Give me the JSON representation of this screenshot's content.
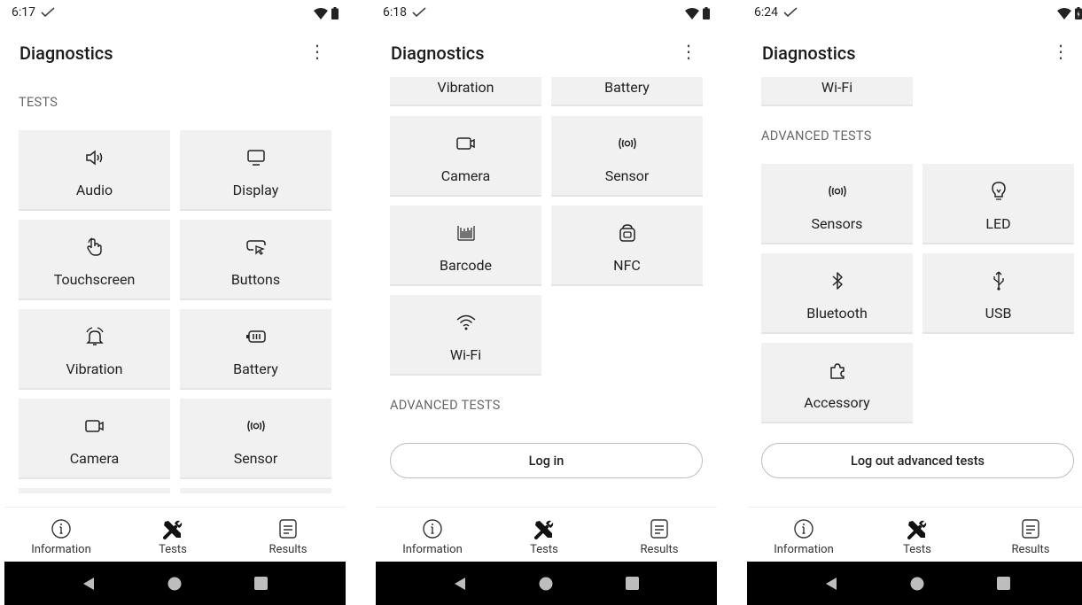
{
  "screens": [
    {
      "time": "6:17",
      "title": "Diagnostics",
      "sections": [
        "TESTS"
      ],
      "tiles": [
        "Audio",
        "Display",
        "Touchscreen",
        "Buttons",
        "Vibration",
        "Battery",
        "Camera",
        "Sensor"
      ]
    },
    {
      "time": "6:18",
      "title": "Diagnostics",
      "sections": [
        "ADVANCED TESTS"
      ],
      "tiles": [
        "Vibration",
        "Battery",
        "Camera",
        "Sensor",
        "Barcode",
        "NFC",
        "Wi-Fi"
      ],
      "button": "Log in"
    },
    {
      "time": "6:24",
      "title": "Diagnostics",
      "sections": [
        "ADVANCED TESTS"
      ],
      "tiles": [
        "Wi-Fi",
        "Sensors",
        "LED",
        "Bluetooth",
        "USB",
        "Accessory"
      ],
      "button": "Log out advanced tests"
    }
  ],
  "nav": {
    "information": "Information",
    "tests": "Tests",
    "results": "Results"
  },
  "colors": {
    "tile_bg": "#f1f1f1",
    "system_nav_bg": "#000000",
    "section_text": "#666666"
  }
}
